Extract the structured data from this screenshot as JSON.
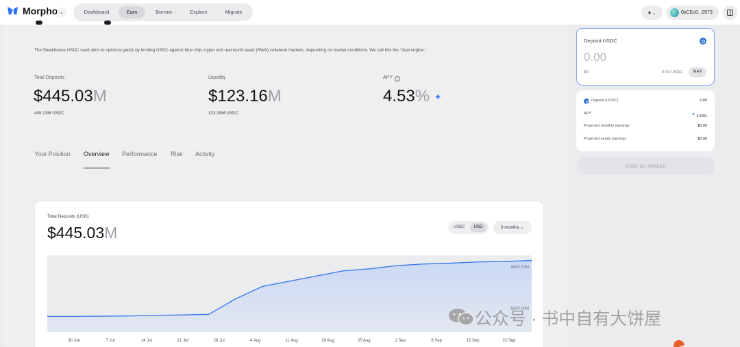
{
  "nav": {
    "brand": "Morpho",
    "items": [
      "Dashboard",
      "Earn",
      "Borrow",
      "Explore",
      "Migrate"
    ],
    "active": "Earn",
    "chain_icon": "ethereum-icon",
    "wallet": "0xCEc6...0573"
  },
  "vault": {
    "description": "The Steakhouse USDC vault aims to optimize yields by lending USDC against blue chip crypto and real world asset (RWA) collateral markets, depending on market conditions. We call this the \"dual engine.\"",
    "stats": [
      {
        "label": "Total Deposits",
        "value": "$445.03",
        "unit": "M",
        "sub": "445.13M USDC"
      },
      {
        "label": "Liquidity",
        "value": "$123.16",
        "unit": "M",
        "sub": "123.19M USDC"
      },
      {
        "label": "APY",
        "value": "4.53",
        "unit": "%",
        "sub": ""
      }
    ]
  },
  "tabs": [
    "Your Position",
    "Overview",
    "Performance",
    "Risk",
    "Activity"
  ],
  "active_tab": "Overview",
  "chart_card": {
    "title": "Total Deposits (USD)",
    "value": "$445.03",
    "unit": "M",
    "toggle": [
      "USDC",
      "USD"
    ],
    "toggle_active": "USD",
    "range": "3 months"
  },
  "chart_data": {
    "type": "area",
    "x": [
      "30 Jun",
      "7 Jul",
      "14 Jul",
      "21 Jul",
      "28 Jul",
      "4 Aug",
      "11 Aug",
      "18 Aug",
      "25 Aug",
      "1 Sep",
      "8 Sep",
      "15 Sep",
      "22 Sep"
    ],
    "y_ticks": [
      "$200.00M",
      "$400.00M"
    ],
    "series": [
      {
        "values": [
          175,
          175,
          176,
          177,
          180,
          182,
          185,
          260,
          320,
          345,
          370,
          395,
          405,
          420,
          428,
          432,
          438,
          440,
          445
        ]
      }
    ],
    "color": "#3a7bf0",
    "fill": "#c9d8f5"
  },
  "deposit": {
    "title": "Deposit USDC",
    "amount": "0.00",
    "usd": "$0",
    "balance": "0.00 USDC",
    "max": "MAX"
  },
  "summary": [
    {
      "label": "Deposit (USDC)",
      "value": "0.00"
    },
    {
      "label": "APY",
      "value": "4.53%"
    },
    {
      "label": "Projected monthly earnings",
      "value": "$0.00"
    },
    {
      "label": "Projected yearly earnings",
      "value": "$0.00"
    }
  ],
  "enter_button": "Enter an amount",
  "watermark": "公众号 · 书中自有大饼屋"
}
